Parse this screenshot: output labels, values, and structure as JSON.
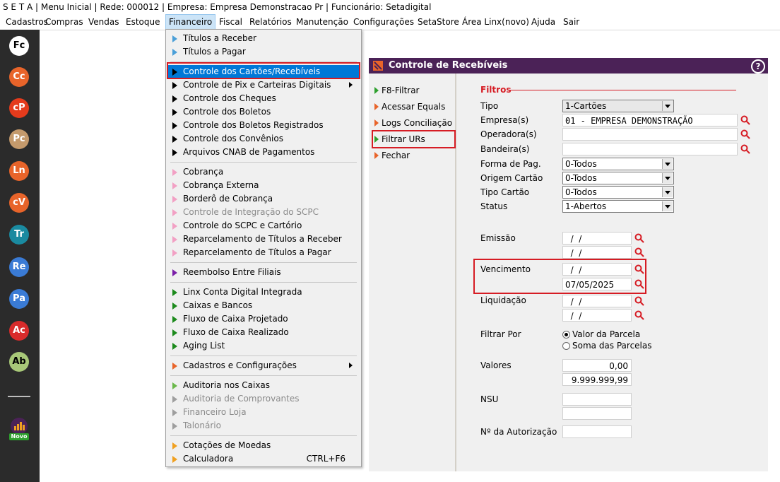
{
  "title": "S E T A | Menu Inicial | Rede: 000012 | Empresa: Empresa Demonstracao Pr | Funcionário: Setadigital",
  "menubar": [
    "Cadastros",
    "Compras",
    "Vendas",
    "Estoque",
    "Financeiro",
    "Fiscal",
    "Relatórios",
    "Manutenção",
    "Configurações",
    "SetaStore",
    "Área Linx(novo)",
    "Ajuda",
    "Sair"
  ],
  "leftbar": {
    "icons": [
      {
        "label": "Fc",
        "color": "#ffffff",
        "text": "#000000"
      },
      {
        "label": "Cc",
        "color": "#e8642a",
        "text": "#ffffff"
      },
      {
        "label": "cP",
        "color": "#e53b1c",
        "text": "#ffffff"
      },
      {
        "label": "Pc",
        "color": "#c49a6c",
        "text": "#ffffff"
      },
      {
        "label": "Ln",
        "color": "#e8642a",
        "text": "#ffffff"
      },
      {
        "label": "cV",
        "color": "#e8642a",
        "text": "#ffffff"
      },
      {
        "label": "Tr",
        "color": "#1a8aa0",
        "text": "#ffffff"
      },
      {
        "label": "Re",
        "color": "#3a7bd5",
        "text": "#ffffff"
      },
      {
        "label": "Pa",
        "color": "#3a7bd5",
        "text": "#ffffff"
      },
      {
        "label": "Ac",
        "color": "#d92b2b",
        "text": "#ffffff"
      },
      {
        "label": "Ab",
        "color": "#a8c878",
        "text": "#000000"
      }
    ],
    "novo_label": "Novo"
  },
  "financeiro_menu": [
    {
      "label": "Títulos a Receber",
      "color": "#4a9fd8"
    },
    {
      "label": "Títulos a Pagar",
      "color": "#4a9fd8"
    },
    {
      "sep": true
    },
    {
      "label": "Controle dos Cartões/Recebíveis",
      "color": "#ffffff",
      "highlight": true
    },
    {
      "label": "Controle de Pix e Carteiras Digitais",
      "color": "#000000",
      "submenu": true
    },
    {
      "label": "Controle dos Cheques",
      "color": "#000000"
    },
    {
      "label": "Controle dos Boletos",
      "color": "#000000"
    },
    {
      "label": "Controle dos Boletos Registrados",
      "color": "#000000"
    },
    {
      "label": "Controle dos Convênios",
      "color": "#000000"
    },
    {
      "label": "Arquivos CNAB de Pagamentos",
      "color": "#000000"
    },
    {
      "sep": true
    },
    {
      "label": "Cobrança",
      "color": "#f2a0c4"
    },
    {
      "label": "Cobrança Externa",
      "color": "#f2a0c4"
    },
    {
      "label": "Borderô de Cobrança",
      "color": "#f2a0c4"
    },
    {
      "label": "Controle de Integração do SCPC",
      "color": "#f2a0c4",
      "disabled": true
    },
    {
      "label": "Controle do SCPC e Cartório",
      "color": "#f2a0c4"
    },
    {
      "label": "Reparcelamento de Títulos a Receber",
      "color": "#f2a0c4"
    },
    {
      "label": "Reparcelamento de Títulos a Pagar",
      "color": "#f2a0c4"
    },
    {
      "sep": true
    },
    {
      "label": "Reembolso Entre Filiais",
      "color": "#7a1fa8"
    },
    {
      "sep": true
    },
    {
      "label": "Linx Conta Digital Integrada",
      "color": "#1c8a1c"
    },
    {
      "label": "Caixas e Bancos",
      "color": "#1c8a1c"
    },
    {
      "label": "Fluxo de Caixa Projetado",
      "color": "#1c8a1c"
    },
    {
      "label": "Fluxo de Caixa Realizado",
      "color": "#1c8a1c"
    },
    {
      "label": "Aging List",
      "color": "#1c8a1c"
    },
    {
      "sep": true
    },
    {
      "label": "Cadastros e Configurações",
      "color": "#e8642a",
      "submenu": true
    },
    {
      "sep": true
    },
    {
      "label": "Auditoria nos Caixas",
      "color": "#6ab84a"
    },
    {
      "label": "Auditoria de Comprovantes",
      "color": "#9e9e9e",
      "disabled": true
    },
    {
      "label": "Financeiro Loja",
      "color": "#9e9e9e",
      "disabled": true
    },
    {
      "label": "Talonário",
      "color": "#9e9e9e",
      "disabled": true
    },
    {
      "sep": true
    },
    {
      "label": "Cotações de Moedas",
      "color": "#f0a020"
    },
    {
      "label": "Calculadora",
      "color": "#f0a020",
      "shortcut": "CTRL+F6"
    }
  ],
  "window": {
    "title": "Controle de Recebíveis",
    "help": "?",
    "side": [
      {
        "label": "F8-Filtrar",
        "color": "#2ea02e"
      },
      {
        "label": "Acessar Equals",
        "color": "#e8642a"
      },
      {
        "label": "Logs Conciliação",
        "color": "#e8642a"
      },
      {
        "label": "Filtrar URs",
        "color": "#2ea02e"
      },
      {
        "label": "Fechar",
        "color": "#e8642a"
      }
    ],
    "filtros_label": "Filtros",
    "fields": {
      "tipo": {
        "label": "Tipo",
        "value": "1-Cartões"
      },
      "empresa": {
        "label": "Empresa(s)",
        "value": "01 - EMPRESA DEMONSTRAÇÃO"
      },
      "operadora": {
        "label": "Operadora(s)",
        "value": ""
      },
      "bandeira": {
        "label": "Bandeira(s)",
        "value": ""
      },
      "forma_pag": {
        "label": "Forma de Pag.",
        "value": "0-Todos"
      },
      "origem": {
        "label": "Origem Cartão",
        "value": "0-Todos"
      },
      "tipo_cartao": {
        "label": "Tipo Cartão",
        "value": "0-Todos"
      },
      "status": {
        "label": "Status",
        "value": "1-Abertos"
      },
      "emissao": {
        "label": "Emissão",
        "from": "  /  /",
        "to": "  /  /"
      },
      "vencimento": {
        "label": "Vencimento",
        "from": "  /  /",
        "to": "07/05/2025"
      },
      "liquidacao": {
        "label": "Liquidação",
        "from": "  /  /",
        "to": "  /  /"
      },
      "filtrar_por": {
        "label": "Filtrar Por",
        "opt1": "Valor da Parcela",
        "opt2": "Soma das Parcelas",
        "selected": "opt1"
      },
      "valores": {
        "label": "Valores",
        "from": "0,00",
        "to": "9.999.999,99"
      },
      "nsu": {
        "label": "NSU",
        "from": "",
        "to": ""
      },
      "autorizacao": {
        "label": "Nº da Autorização",
        "value": ""
      }
    }
  }
}
